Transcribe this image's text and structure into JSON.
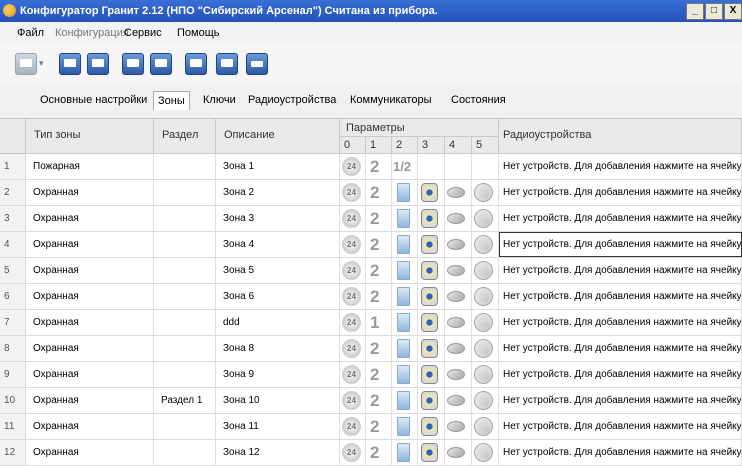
{
  "window": {
    "title": "Конфигуратор Гранит 2.12 (НПО \"Сибирский Арсенал\")   Считана из прибора."
  },
  "menu": [
    {
      "label": "Файл",
      "enabled": true
    },
    {
      "label": "Конфигурация",
      "enabled": false
    },
    {
      "label": "Сервис",
      "enabled": true
    },
    {
      "label": "Помощь",
      "enabled": true
    }
  ],
  "tabs": [
    "Основные настройки",
    "Зоны",
    "Ключи",
    "Радиоустройства",
    "Коммуникаторы",
    "Состояния"
  ],
  "active_tab": "Зоны",
  "table": {
    "headers": {
      "type": "Тип зоны",
      "section": "Раздел",
      "description": "Описание",
      "params": "Параметры",
      "radio": "Радиоустройства"
    },
    "param_columns": [
      "0",
      "1",
      "2",
      "3",
      "4",
      "5"
    ],
    "badge_text": "24",
    "rows": [
      {
        "num": "1",
        "type": "Пожарная",
        "section": "",
        "description": "Зона 1",
        "p1": "2",
        "p2": "1/2",
        "icons": false,
        "radio": "Нет устройств. Для добавления нажмите на ячейку."
      },
      {
        "num": "2",
        "type": "Охранная",
        "section": "",
        "description": "Зона 2",
        "p1": "2",
        "p2": "",
        "icons": true,
        "radio": "Нет устройств. Для добавления нажмите на ячейку."
      },
      {
        "num": "3",
        "type": "Охранная",
        "section": "",
        "description": "Зона 3",
        "p1": "2",
        "p2": "",
        "icons": true,
        "radio": "Нет устройств. Для добавления нажмите на ячейку."
      },
      {
        "num": "4",
        "type": "Охранная",
        "section": "",
        "description": "Зона 4",
        "p1": "2",
        "p2": "",
        "icons": true,
        "radio": "Нет устройств. Для добавления нажмите на ячейку.",
        "selected": true
      },
      {
        "num": "5",
        "type": "Охранная",
        "section": "",
        "description": "Зона 5",
        "p1": "2",
        "p2": "",
        "icons": true,
        "radio": "Нет устройств. Для добавления нажмите на ячейку."
      },
      {
        "num": "6",
        "type": "Охранная",
        "section": "",
        "description": "Зона 6",
        "p1": "2",
        "p2": "",
        "icons": true,
        "radio": "Нет устройств. Для добавления нажмите на ячейку."
      },
      {
        "num": "7",
        "type": "Охранная",
        "section": "",
        "description": "ddd",
        "p1": "1",
        "p2": "",
        "icons": true,
        "radio": "Нет устройств. Для добавления нажмите на ячейку."
      },
      {
        "num": "8",
        "type": "Охранная",
        "section": "",
        "description": "Зона 8",
        "p1": "2",
        "p2": "",
        "icons": true,
        "radio": "Нет устройств. Для добавления нажмите на ячейку."
      },
      {
        "num": "9",
        "type": "Охранная",
        "section": "",
        "description": "Зона 9",
        "p1": "2",
        "p2": "",
        "icons": true,
        "radio": "Нет устройств. Для добавления нажмите на ячейку."
      },
      {
        "num": "10",
        "type": "Охранная",
        "section": "Раздел 1",
        "description": "Зона 10",
        "p1": "2",
        "p2": "",
        "icons": true,
        "radio": "Нет устройств. Для добавления нажмите на ячейку."
      },
      {
        "num": "11",
        "type": "Охранная",
        "section": "",
        "description": "Зона 11",
        "p1": "2",
        "p2": "",
        "icons": true,
        "radio": "Нет устройств. Для добавления нажмите на ячейку."
      },
      {
        "num": "12",
        "type": "Охранная",
        "section": "",
        "description": "Зона 12",
        "p1": "2",
        "p2": "",
        "icons": true,
        "radio": "Нет устройств. Для добавления нажмите на ячейку."
      }
    ]
  }
}
